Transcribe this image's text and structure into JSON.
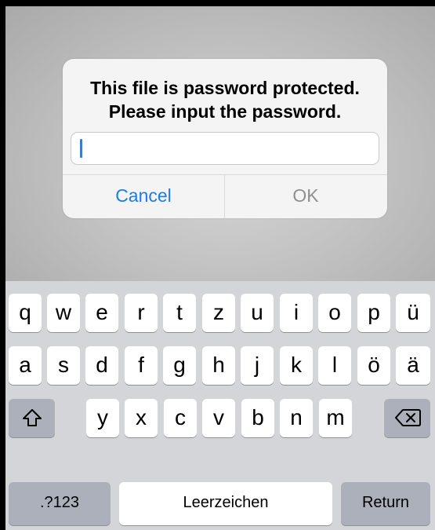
{
  "dialog": {
    "title_line1": "This file is password protected.",
    "title_line2": "Please input the password.",
    "password_value": "",
    "cancel_label": "Cancel",
    "ok_label": "OK"
  },
  "keyboard": {
    "row1": [
      "q",
      "w",
      "e",
      "r",
      "t",
      "z",
      "u",
      "i",
      "o",
      "p",
      "ü"
    ],
    "row2": [
      "a",
      "s",
      "d",
      "f",
      "g",
      "h",
      "j",
      "k",
      "l",
      "ö",
      "ä"
    ],
    "row3": [
      "y",
      "x",
      "c",
      "v",
      "b",
      "n",
      "m"
    ],
    "shift_icon": "shift-icon",
    "backspace_icon": "backspace-icon",
    "numbers_label": ".?123",
    "space_label": "Leerzeichen",
    "return_label": "Return"
  },
  "colors": {
    "link_blue": "#1a7cf0",
    "disabled_gray": "#8f8f8f",
    "caret_blue": "#3a7bd5",
    "keyboard_bg": "#d3d5d9",
    "function_key_bg": "#abb0ba"
  }
}
